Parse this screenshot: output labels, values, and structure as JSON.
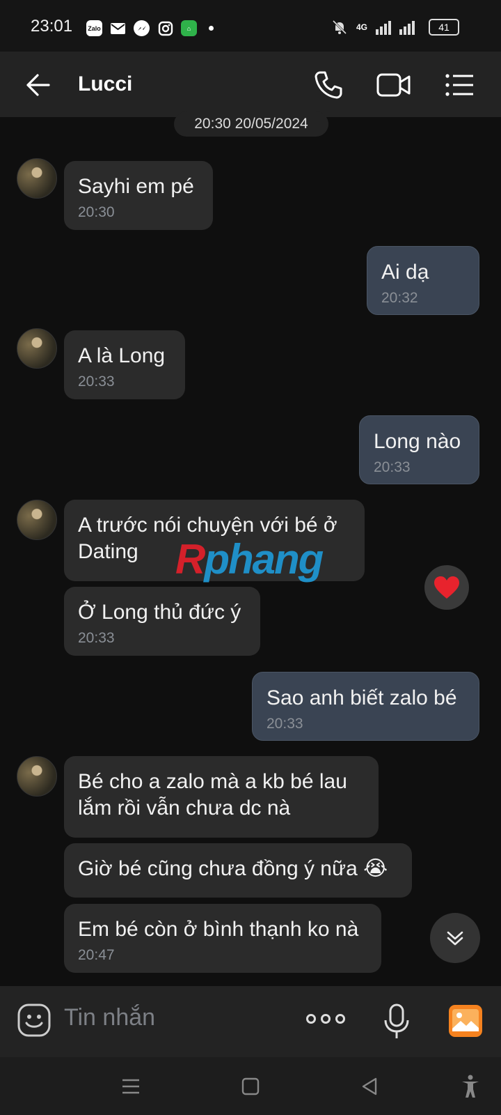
{
  "status_bar": {
    "time": "23:01",
    "network": "4G",
    "battery": "41",
    "app_icons": [
      "zalo-icon",
      "mail-icon",
      "messenger-icon",
      "instagram-icon",
      "shop-icon"
    ]
  },
  "header": {
    "contact_name": "Lucci"
  },
  "chat": {
    "date_separator": "20:30 20/05/2024",
    "messages": [
      {
        "text": "Sayhi em pé",
        "time": "20:30"
      },
      {
        "text": "Ai dạ",
        "time": "20:32"
      },
      {
        "text": "A là Long",
        "time": "20:33"
      },
      {
        "text": "Long nào",
        "time": "20:33"
      },
      {
        "text": "A trước nói chuyện với bé ở\nDating",
        "time": ""
      },
      {
        "text": "Ở Long thủ đức ý",
        "time": "20:33"
      },
      {
        "text": "Sao anh biết zalo bé",
        "time": "20:33"
      },
      {
        "text": "Bé cho a zalo mà a kb bé lau\nlắm rồi vẫn chưa dc nà",
        "time": ""
      },
      {
        "text": "Giờ bé cũng chưa đồng ý nữa 😭",
        "time": ""
      },
      {
        "text": "Em bé còn ở bình thạnh ko nà",
        "time": "20:47"
      }
    ],
    "reaction": "❤️"
  },
  "watermark": {
    "first": "R",
    "rest": "phang"
  },
  "composer": {
    "placeholder": "Tin nhắn"
  },
  "colors": {
    "background": "#0f0f0f",
    "incoming_bubble": "#2b2b2b",
    "outgoing_bubble": "#3a4453",
    "accent_orange": "#f5821f"
  }
}
